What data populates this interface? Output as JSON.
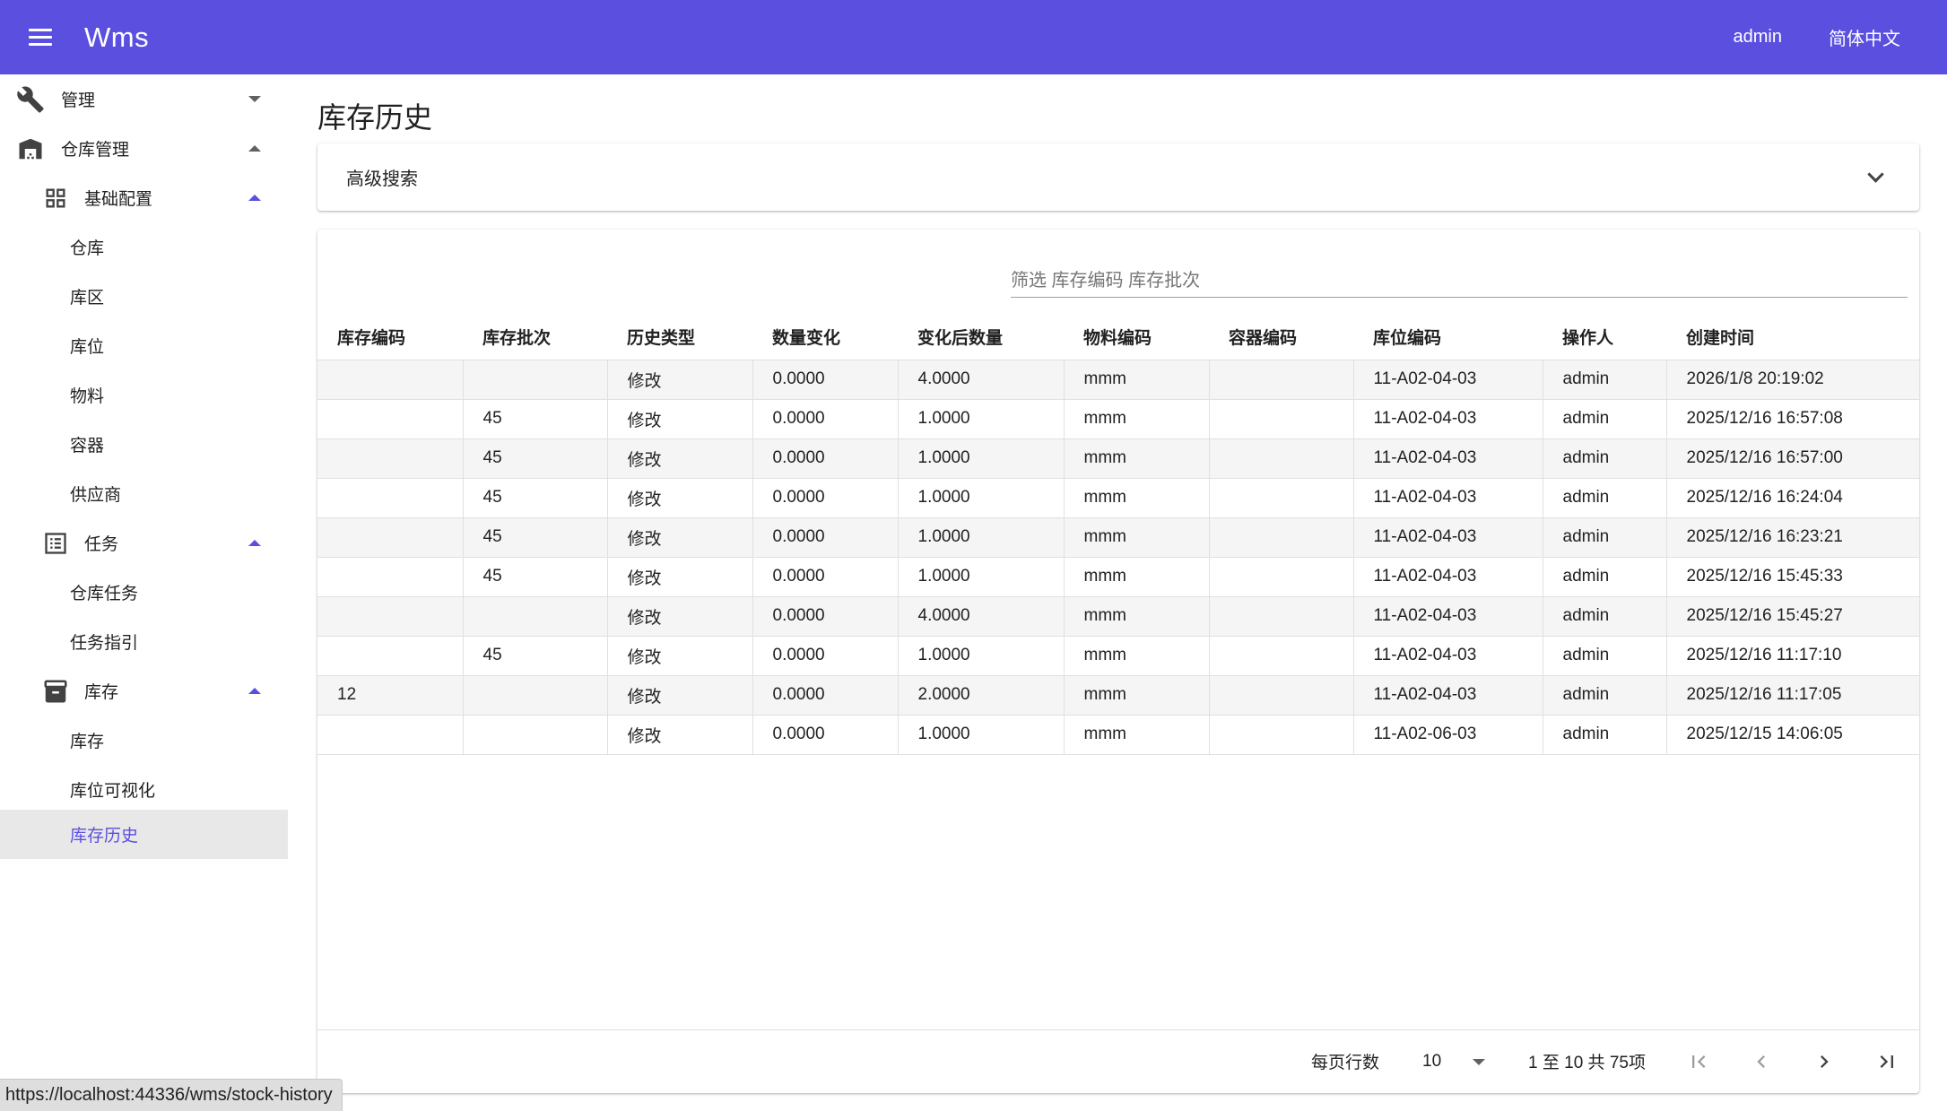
{
  "app": {
    "title": "Wms",
    "user": "admin",
    "language": "简体中文"
  },
  "sidebar": {
    "items": [
      {
        "label": "管理",
        "icon": "wrench-icon",
        "level": 0,
        "caret": "down"
      },
      {
        "label": "仓库管理",
        "icon": "warehouse-icon",
        "level": 0,
        "caret": "up"
      },
      {
        "label": "基础配置",
        "icon": "grid-icon",
        "level": 1,
        "caret": "up"
      },
      {
        "label": "仓库",
        "level": 2
      },
      {
        "label": "库区",
        "level": 2
      },
      {
        "label": "库位",
        "level": 2
      },
      {
        "label": "物料",
        "level": 2
      },
      {
        "label": "容器",
        "level": 2
      },
      {
        "label": "供应商",
        "level": 2
      },
      {
        "label": "任务",
        "icon": "list-icon",
        "level": 1,
        "caret": "up"
      },
      {
        "label": "仓库任务",
        "level": 2
      },
      {
        "label": "任务指引",
        "level": 2
      },
      {
        "label": "库存",
        "icon": "archive-icon",
        "level": 1,
        "caret": "up"
      },
      {
        "label": "库存",
        "level": 2
      },
      {
        "label": "库位可视化",
        "level": 2
      },
      {
        "label": "库存历史",
        "level": 2,
        "active": true
      }
    ]
  },
  "main": {
    "page_title": "库存历史",
    "advanced_search": "高级搜索",
    "filter_placeholder": "筛选 库存编码 库存批次",
    "columns": [
      "库存编码",
      "库存批次",
      "历史类型",
      "数量变化",
      "变化后数量",
      "物料编码",
      "容器编码",
      "库位编码",
      "操作人",
      "创建时间"
    ],
    "rows": [
      [
        "",
        "",
        "修改",
        "0.0000",
        "4.0000",
        "mmm",
        "",
        "11-A02-04-03",
        "admin",
        "2026/1/8 20:19:02"
      ],
      [
        "",
        "45",
        "修改",
        "0.0000",
        "1.0000",
        "mmm",
        "",
        "11-A02-04-03",
        "admin",
        "2025/12/16 16:57:08"
      ],
      [
        "",
        "45",
        "修改",
        "0.0000",
        "1.0000",
        "mmm",
        "",
        "11-A02-04-03",
        "admin",
        "2025/12/16 16:57:00"
      ],
      [
        "",
        "45",
        "修改",
        "0.0000",
        "1.0000",
        "mmm",
        "",
        "11-A02-04-03",
        "admin",
        "2025/12/16 16:24:04"
      ],
      [
        "",
        "45",
        "修改",
        "0.0000",
        "1.0000",
        "mmm",
        "",
        "11-A02-04-03",
        "admin",
        "2025/12/16 16:23:21"
      ],
      [
        "",
        "45",
        "修改",
        "0.0000",
        "1.0000",
        "mmm",
        "",
        "11-A02-04-03",
        "admin",
        "2025/12/16 15:45:33"
      ],
      [
        "",
        "",
        "修改",
        "0.0000",
        "4.0000",
        "mmm",
        "",
        "11-A02-04-03",
        "admin",
        "2025/12/16 15:45:27"
      ],
      [
        "",
        "45",
        "修改",
        "0.0000",
        "1.0000",
        "mmm",
        "",
        "11-A02-04-03",
        "admin",
        "2025/12/16 11:17:10"
      ],
      [
        "12",
        "",
        "修改",
        "0.0000",
        "2.0000",
        "mmm",
        "",
        "11-A02-04-03",
        "admin",
        "2025/12/16 11:17:05"
      ],
      [
        "",
        "",
        "修改",
        "0.0000",
        "1.0000",
        "mmm",
        "",
        "11-A02-06-03",
        "admin",
        "2025/12/15 14:06:05"
      ]
    ],
    "pagination": {
      "rows_per_page_label": "每页行数",
      "rows_per_page": "10",
      "range": "1 至 10 共 75项"
    }
  },
  "status_url": "https://localhost:44336/wms/stock-history",
  "colors": {
    "primary": "#5b4fe0",
    "active_bg": "#e8e8e8"
  }
}
